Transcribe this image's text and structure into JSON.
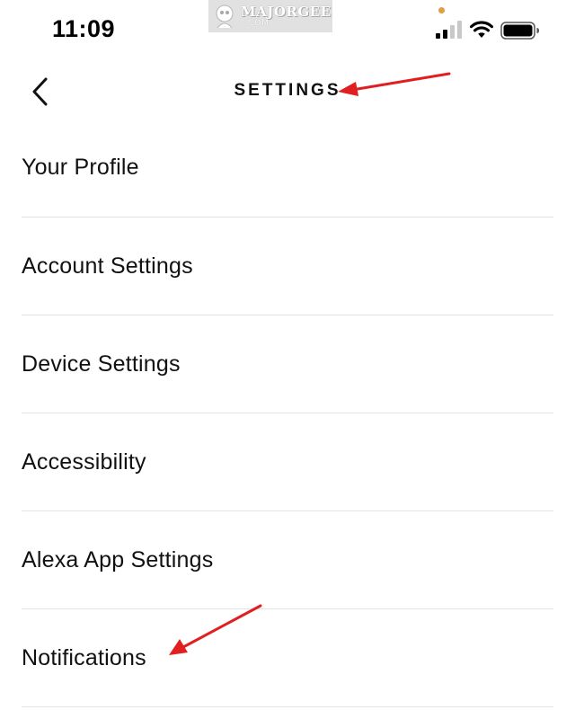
{
  "status_bar": {
    "time": "11:09",
    "icons": [
      "privacy-dot",
      "cellular-signal-icon",
      "wifi-icon",
      "battery-icon"
    ],
    "privacy_dot_color": "#e0a040"
  },
  "watermark": {
    "brand": "MAJORGEEKS",
    "domain": ".COM"
  },
  "header": {
    "back_icon": "chevron-left-icon",
    "title": "SETTINGS"
  },
  "settings": {
    "items": [
      {
        "label": "Your Profile"
      },
      {
        "label": "Account Settings"
      },
      {
        "label": "Device Settings"
      },
      {
        "label": "Accessibility"
      },
      {
        "label": "Alexa App Settings"
      },
      {
        "label": "Notifications"
      }
    ]
  },
  "annotations": {
    "arrow_color": "#e02020",
    "targets": [
      "page-title",
      "settings-item-notifications"
    ]
  },
  "colors": {
    "background": "#ffffff",
    "text": "#111111",
    "divider": "#e3e3e3"
  }
}
